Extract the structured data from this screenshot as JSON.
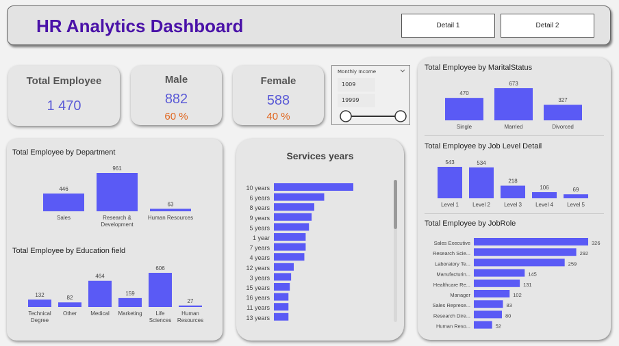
{
  "header": {
    "title": "HR Analytics Dashboard",
    "buttons": [
      "Detail 1",
      "Detail 2"
    ]
  },
  "kpis": {
    "total": {
      "title": "Total Employee",
      "value": "1 470"
    },
    "male": {
      "title": "Male",
      "value": "882",
      "pct": "60 %"
    },
    "female": {
      "title": "Female",
      "value": "588",
      "pct": "40 %"
    }
  },
  "slicer": {
    "title": "Monthly Income",
    "min": "1009",
    "max": "19999"
  },
  "colors": {
    "bar": "#5a5af5",
    "accent_title": "#4a12a8",
    "pct": "#e0661f",
    "kpi_value": "#5a5ad6"
  },
  "icons": {
    "slicer_dropdown": "chevron-down-icon"
  },
  "chart_data": [
    {
      "id": "department",
      "type": "bar",
      "title": "Total Employee by Department",
      "categories": [
        "Sales",
        "Research & Development",
        "Human Resources"
      ],
      "values": [
        446,
        961,
        63
      ]
    },
    {
      "id": "education",
      "type": "bar",
      "title": "Total Employee by Education field",
      "categories": [
        "Technical Degree",
        "Other",
        "Medical",
        "Marketing",
        "Life Sciences",
        "Human Resources"
      ],
      "values": [
        132,
        82,
        464,
        159,
        606,
        27
      ]
    },
    {
      "id": "services",
      "type": "bar",
      "orientation": "horizontal",
      "title": "Services years",
      "categories": [
        "10 years",
        "6 years",
        "8 years",
        "9 years",
        "5 years",
        "1 year",
        "7 years",
        "4 years",
        "12 years",
        "3 years",
        "15 years",
        "16 years",
        "11 years",
        "13 years"
      ],
      "values": [
        120,
        76,
        61,
        57,
        53,
        48,
        48,
        46,
        30,
        26,
        24,
        22,
        22,
        22
      ]
    },
    {
      "id": "marital",
      "type": "bar",
      "title": "Total Employee by MaritalStatus",
      "categories": [
        "Single",
        "Married",
        "Divorced"
      ],
      "values": [
        470,
        673,
        327
      ]
    },
    {
      "id": "joblevel",
      "type": "bar",
      "title": "Total Employee by Job Level Detail",
      "categories": [
        "Level 1",
        "Level 2",
        "Level 3",
        "Level 4",
        "Level 5"
      ],
      "values": [
        543,
        534,
        218,
        106,
        69
      ]
    },
    {
      "id": "jobrole",
      "type": "bar",
      "orientation": "horizontal",
      "title": "Total Employee by JobRole",
      "categories": [
        "Sales Executive",
        "Research Scie...",
        "Laboratory Te...",
        "Manufacturin...",
        "Healthcare Re...",
        "Manager",
        "Sales Represe...",
        "Research Dire...",
        "Human Reso..."
      ],
      "values": [
        326,
        292,
        259,
        145,
        131,
        102,
        83,
        80,
        52
      ]
    }
  ]
}
